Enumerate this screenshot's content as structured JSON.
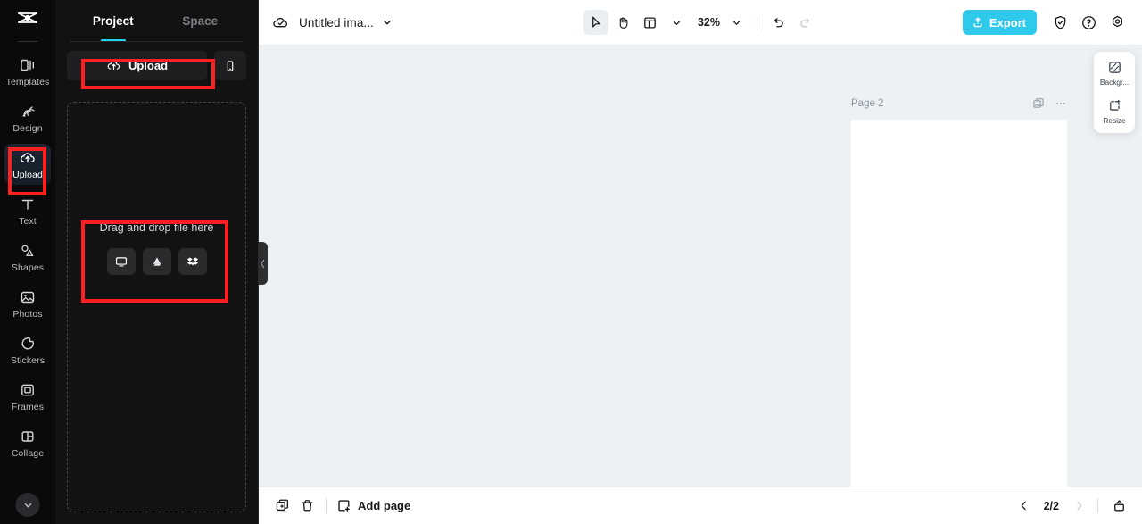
{
  "app": {
    "brand": "capcut-logo",
    "accent_cyan": "#22d3ee",
    "export_blue": "#2fc9ec",
    "annotation_red": "#fe2020"
  },
  "left_rail": {
    "items": [
      {
        "label": "Templates",
        "icon": "templates-icon",
        "active": false
      },
      {
        "label": "Design",
        "icon": "design-icon",
        "active": false
      },
      {
        "label": "Upload",
        "icon": "upload-cloud-icon",
        "active": true
      },
      {
        "label": "Text",
        "icon": "text-icon",
        "active": false
      },
      {
        "label": "Shapes",
        "icon": "shapes-icon",
        "active": false
      },
      {
        "label": "Photos",
        "icon": "photos-icon",
        "active": false
      },
      {
        "label": "Stickers",
        "icon": "stickers-icon",
        "active": false
      },
      {
        "label": "Frames",
        "icon": "frames-icon",
        "active": false
      },
      {
        "label": "Collage",
        "icon": "collage-icon",
        "active": false
      }
    ],
    "collapse_icon": "chevron-down-icon"
  },
  "panel": {
    "tabs": [
      {
        "label": "Project",
        "active": true
      },
      {
        "label": "Space",
        "active": false
      }
    ],
    "upload_button_label": "Upload",
    "upload_button_icon": "upload-cloud-icon",
    "mobile_button_icon": "mobile-phone-icon",
    "dropzone_text": "Drag and drop file here",
    "sources": [
      {
        "name": "computer-icon"
      },
      {
        "name": "google-drive-icon"
      },
      {
        "name": "dropbox-icon"
      }
    ],
    "collapse_handle_icon": "chevron-left-icon"
  },
  "topbar": {
    "cloud_icon": "cloud-check-icon",
    "doc_title": "Untitled ima...",
    "doc_caret_icon": "chevron-down-icon",
    "tools": [
      {
        "name": "select-arrow-icon",
        "selected": true
      },
      {
        "name": "hand-pan-icon",
        "selected": false
      },
      {
        "name": "layout-grid-icon",
        "selected": false
      }
    ],
    "layout_caret_icon": "chevron-down-icon",
    "zoom_value": "32%",
    "zoom_caret_icon": "chevron-down-icon",
    "undo_icon": "undo-icon",
    "redo_icon": "redo-icon",
    "export_label": "Export",
    "export_icon": "export-upload-icon",
    "right_icons": [
      {
        "name": "shield-check-icon"
      },
      {
        "name": "help-question-icon"
      },
      {
        "name": "settings-gear-icon"
      }
    ]
  },
  "canvas": {
    "page_label": "Page 2",
    "page_head_icons": [
      {
        "name": "duplicate-page-icon"
      },
      {
        "name": "more-options-icon"
      }
    ],
    "float_tools": [
      {
        "label": "Backgr...",
        "icon": "background-icon"
      },
      {
        "label": "Resize",
        "icon": "resize-icon"
      }
    ]
  },
  "bottombar": {
    "duplicate_icon": "duplicate-icon",
    "delete_icon": "trash-icon",
    "add_page_label": "Add page",
    "add_page_icon": "add-page-icon",
    "prev_icon": "chevron-left-icon",
    "next_icon": "chevron-right-icon",
    "page_counter": "2/2",
    "present_icon": "present-icon"
  }
}
